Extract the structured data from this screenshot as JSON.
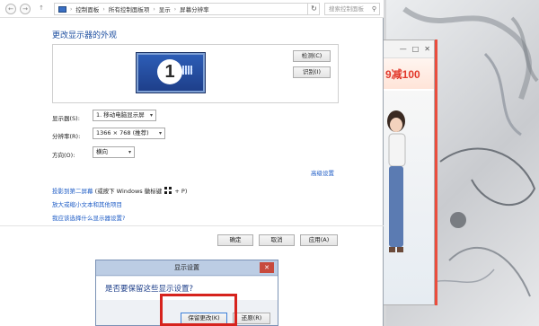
{
  "address_bar": {
    "back_label": "←",
    "forward_label": "→",
    "up_label": "↑",
    "breadcrumb": [
      "控制面板",
      "所有控制面板项",
      "显示",
      "屏幕分辨率"
    ],
    "refresh_label": "↻",
    "search_placeholder": "搜索控制面板",
    "search_icon": "⚲"
  },
  "main": {
    "title": "更改显示器的外观",
    "monitor_number": "1",
    "detect_label": "检测(C)",
    "identify_label": "识别(I)",
    "display_label": "显示器(S):",
    "display_value": "1. 移动电脑显示屏",
    "resolution_label": "分辨率(R):",
    "resolution_value": "1366 × 768 (推荐)",
    "orientation_label": "方向(O):",
    "orientation_value": "横向",
    "advanced_link": "高级设置",
    "project_link": "投影到第二屏幕",
    "project_hint_before": "(或按下 Windows 徽标键",
    "project_hint_after": "+ P)",
    "enlarge_link": "放大或缩小文本和其他项目",
    "help_link": "我应该选择什么显示器设置?",
    "ok_label": "确定",
    "cancel_label": "取消",
    "apply_label": "应用(A)"
  },
  "dialog": {
    "title": "显示设置",
    "close_label": "✕",
    "question": "是否要保留这些显示设置?",
    "keep_label": "保留更改(K)",
    "revert_label": "还原(R)"
  },
  "ad_window": {
    "minimize_label": "—",
    "maximize_label": "□",
    "close_label": "✕",
    "banner": "9减100"
  },
  "colors": {
    "link": "#1e5cc6",
    "title": "#1e4fa0",
    "highlight": "#d6231d"
  }
}
